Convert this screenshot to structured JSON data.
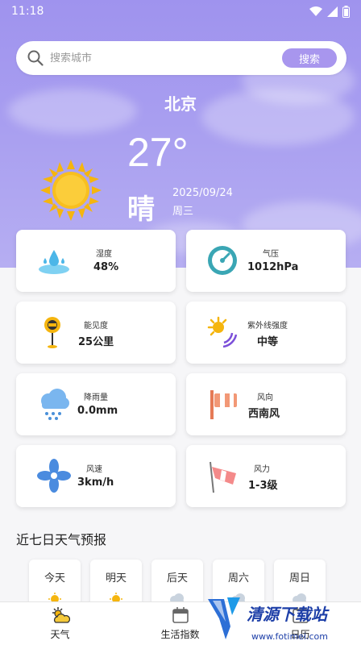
{
  "status": {
    "time": "11:18"
  },
  "search": {
    "placeholder": "搜索城市",
    "button": "搜索"
  },
  "current": {
    "city": "北京",
    "temperature": "27°",
    "condition": "晴",
    "date": "2025/09/24",
    "weekday": "周三"
  },
  "cards": [
    {
      "label": "湿度",
      "value": "48%",
      "icon": "humidity-icon"
    },
    {
      "label": "气压",
      "value": "1012hPa",
      "icon": "pressure-gauge-icon"
    },
    {
      "label": "能见度",
      "value": "25公里",
      "icon": "visibility-sign-icon"
    },
    {
      "label": "紫外线强度",
      "value": "中等",
      "icon": "uv-sun-icon"
    },
    {
      "label": "降雨量",
      "value": "0.0mm",
      "icon": "rain-cloud-icon"
    },
    {
      "label": "风向",
      "value": "西南风",
      "icon": "wind-direction-icon"
    },
    {
      "label": "风速",
      "value": "3km/h",
      "icon": "fan-icon"
    },
    {
      "label": "风力",
      "value": "1-3级",
      "icon": "windsock-icon"
    }
  ],
  "forecast": {
    "title": "近七日天气预报",
    "days": [
      {
        "day": "今天",
        "icon": "sun-icon"
      },
      {
        "day": "明天",
        "icon": "sun-icon"
      },
      {
        "day": "后天",
        "icon": "cloud-icon"
      },
      {
        "day": "周六",
        "icon": "cloud-icon"
      },
      {
        "day": "周日",
        "icon": "cloud-icon"
      }
    ]
  },
  "nav": [
    {
      "label": "天气",
      "icon": "weather-icon"
    },
    {
      "label": "生活指数",
      "icon": "calendar-icon"
    },
    {
      "label": "日历",
      "icon": "calendar-icon"
    }
  ],
  "watermark": {
    "title": "清源下载站",
    "url": "www.fotimei.com"
  },
  "colors": {
    "hero": "#a89ef0",
    "accent": "#a896ee",
    "sun": "#f5b50e"
  }
}
